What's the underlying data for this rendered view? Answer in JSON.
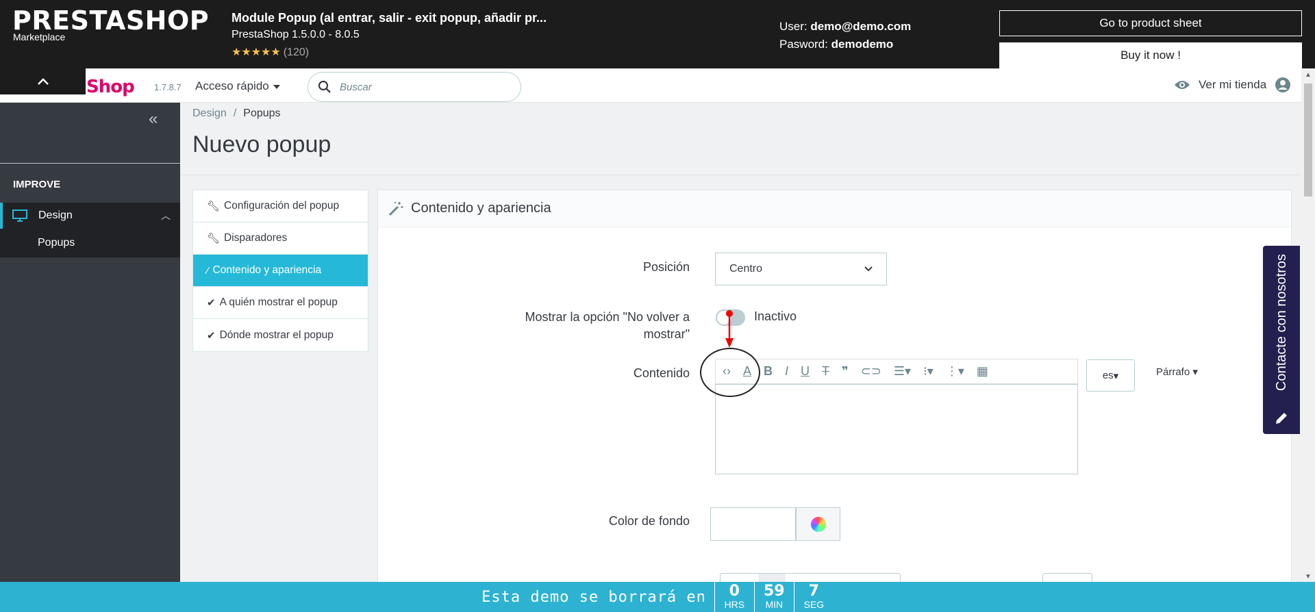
{
  "marketplace": {
    "logo": "PRESTASHOP",
    "sub": "Marketplace",
    "title": "Module Popup (al entrar, salir - exit popup, añadir pr...",
    "version": "PrestaShop 1.5.0.0 - 8.0.5",
    "stars": "★★★★★",
    "rating_count": "(120)",
    "user_label": "User:",
    "user_value": "demo@demo.com",
    "password_label": "Pasword:",
    "password_value": "demodemo",
    "product_sheet_btn": "Go to product sheet",
    "buy_btn": "Buy it now !"
  },
  "header": {
    "logo_text": "taShop",
    "version": "1.7.8.7",
    "quick_access": "Acceso rápido",
    "search_placeholder": "Buscar",
    "view_store": "Ver mi tienda"
  },
  "sidebar": {
    "section": "IMPROVE",
    "design": "Design",
    "popups": "Popups"
  },
  "breadcrumb": {
    "parent": "Design",
    "separator": "/",
    "current": "Popups"
  },
  "page_title": "Nuevo popup",
  "tabs": [
    {
      "label": "Configuración del popup",
      "icon": "wrench-icon"
    },
    {
      "label": "Disparadores",
      "icon": "wrench-icon"
    },
    {
      "label": "Contenido y apariencia",
      "icon": "magic-wand-icon"
    },
    {
      "label": "A quién mostrar el popup",
      "icon": "check-icon"
    },
    {
      "label": "Dónde mostrar el popup",
      "icon": "check-icon"
    }
  ],
  "panel": {
    "title": "Contenido y apariencia",
    "position_label": "Posición",
    "position_value": "Centro",
    "no_show_label": "Mostrar la opción \"No volver a mostrar\"",
    "toggle_state": "Inactivo",
    "content_label": "Contenido",
    "lang": "es",
    "paragraph": "Párrafo",
    "bg_color_label": "Color de fondo"
  },
  "contact_tab": "Contacte con nosotros",
  "countdown": {
    "text": "Esta demo se borrará en",
    "hours": "0",
    "hours_label": "HRS",
    "minutes": "59",
    "minutes_label": "MIN",
    "seconds": "7",
    "seconds_label": "SEG"
  },
  "colors": {
    "accent": "#25b9d7",
    "brand": "#df0067",
    "sidebar": "#363a41",
    "contact": "#231f4e",
    "countdown": "#2eb2d1"
  }
}
